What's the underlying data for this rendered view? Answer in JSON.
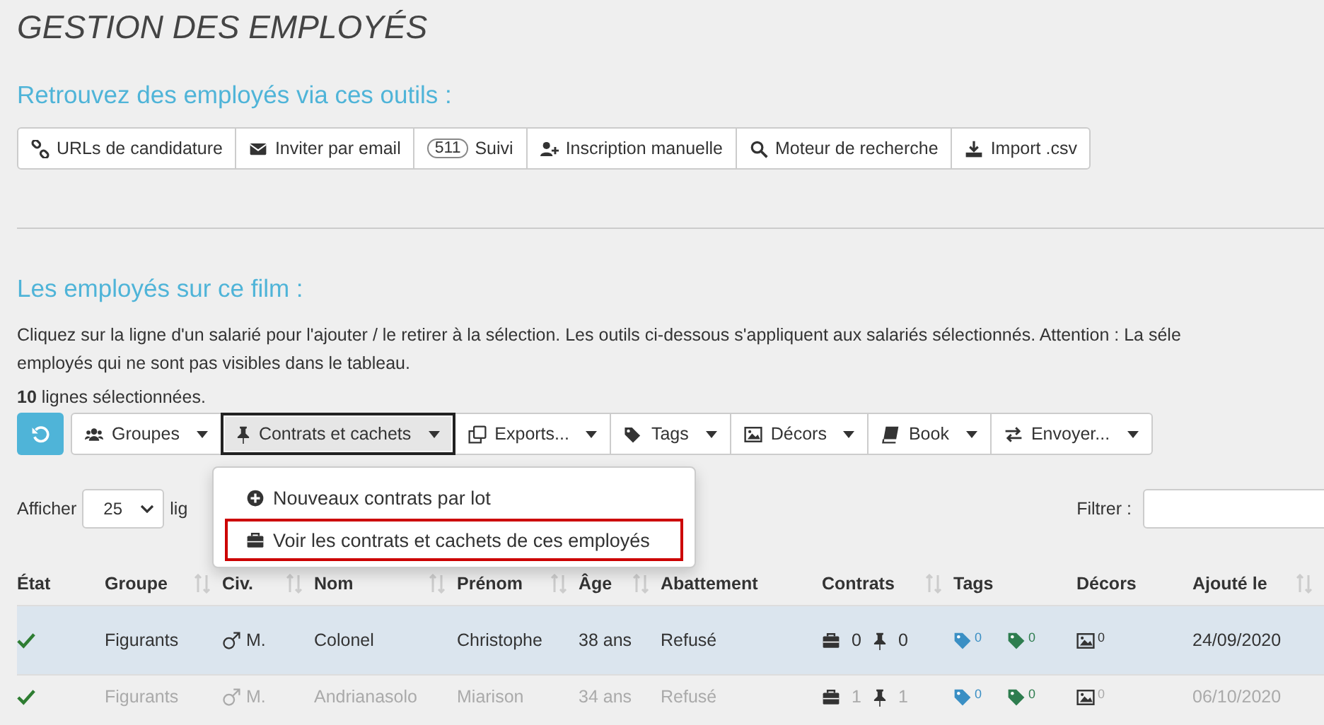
{
  "title": "GESTION DES EMPLOYÉS",
  "tools_heading": "Retrouvez des employés via ces outils :",
  "tools": [
    {
      "kind": "link",
      "label": "URLs de candidature"
    },
    {
      "kind": "mail",
      "label": "Inviter par email"
    },
    {
      "kind": "badge",
      "badge": "511",
      "label": "Suivi"
    },
    {
      "kind": "adduser",
      "label": "Inscription manuelle"
    },
    {
      "kind": "search",
      "label": "Moteur de recherche"
    },
    {
      "kind": "download",
      "label": "Import .csv"
    }
  ],
  "employees_heading": "Les employés sur ce film :",
  "intro": [
    "Cliquez sur la ligne d'un salarié pour l'ajouter / le retirer à la sélection. Les outils ci-dessous s'appliquent aux salariés sélectionnés. Attention : La séle",
    "employés qui ne sont pas visibles dans le tableau."
  ],
  "selection_count": "**10** lignes sélectionnées.",
  "actions": [
    {
      "kind": "users",
      "label": "Groupes",
      "selected": false
    },
    {
      "kind": "pin",
      "label": "Contrats et cachets",
      "selected": true
    },
    {
      "kind": "copy",
      "label": "Exports...",
      "selected": false
    },
    {
      "kind": "tags",
      "label": "Tags",
      "selected": false
    },
    {
      "kind": "image",
      "label": "Décors",
      "selected": false
    },
    {
      "kind": "book",
      "label": "Book",
      "selected": false
    },
    {
      "kind": "swap",
      "label": "Envoyer...",
      "selected": false
    }
  ],
  "menu": [
    {
      "kind": "plus",
      "label": "Nouveaux contrats par lot",
      "selected": false
    },
    {
      "kind": "briefcase",
      "label": "Voir les contrats et cachets de ces employés",
      "selected": true
    }
  ],
  "length_label": "Afficher",
  "length_value": "25",
  "length_after": "lig",
  "filter_label": "Filtrer :",
  "columns": [
    {
      "label": "État",
      "sortable": false
    },
    {
      "label": "Groupe",
      "sortable": true
    },
    {
      "label": "Civ.",
      "sortable": true
    },
    {
      "label": "Nom",
      "sortable": true
    },
    {
      "label": "Prénom",
      "sortable": true
    },
    {
      "label": "Âge",
      "sortable": true
    },
    {
      "label": "Abattement",
      "sortable": false
    },
    {
      "label": "Contrats",
      "sortable": true
    },
    {
      "label": "Tags",
      "sortable": false
    },
    {
      "label": "Décors",
      "sortable": false
    },
    {
      "label": "Ajouté le",
      "sortable": true
    }
  ],
  "rows": [
    {
      "selected": true,
      "checked": true,
      "groupe": "Figurants",
      "civ": "M.",
      "nom": "Colonel",
      "prenom": "Christophe",
      "age": "38 ans",
      "abattement": "Refusé",
      "contrats": "0",
      "cachets": "0",
      "tags": [
        "0",
        "0"
      ],
      "decors": "0",
      "ajoute": "24/09/2020"
    },
    {
      "selected": false,
      "checked": true,
      "groupe": "Figurants",
      "civ": "M.",
      "nom": "Andrianasolo",
      "prenom": "Miarison",
      "age": "34 ans",
      "abattement": "Refusé",
      "contrats": "1",
      "cachets": "1",
      "tags": [
        "0",
        "0"
      ],
      "decors": "0",
      "ajoute": "06/10/2020"
    }
  ]
}
